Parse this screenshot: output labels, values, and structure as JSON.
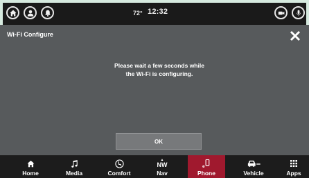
{
  "status_bar": {
    "temperature": "72°",
    "time": "12:32",
    "left_buttons": [
      "home-icon",
      "user-icon",
      "bell-icon"
    ],
    "right_buttons": [
      "camera-icon",
      "microphone-icon"
    ]
  },
  "dialog": {
    "title": "Wi-Fi Configure",
    "message_line1": "Please wait a few seconds while",
    "message_line2": "the Wi-Fi is configuring.",
    "ok_label": "OK",
    "close_icon": "close-icon"
  },
  "nav": {
    "items": [
      {
        "label": "Home",
        "icon": "home-icon"
      },
      {
        "label": "Media",
        "icon": "music-note-icon"
      },
      {
        "label": "Comfort",
        "icon": "seat-icon"
      },
      {
        "label": "Nav",
        "icon": "compass-icon",
        "heading": "NW"
      },
      {
        "label": "Phone",
        "icon": "phone-icon",
        "active": true
      },
      {
        "label": "Vehicle",
        "icon": "car-icon"
      },
      {
        "label": "Apps",
        "icon": "grid-icon"
      }
    ]
  },
  "colors": {
    "active_tab": "#a0192e",
    "screen_bg": "#575a5c",
    "bar_bg": "#1c1c1c"
  }
}
